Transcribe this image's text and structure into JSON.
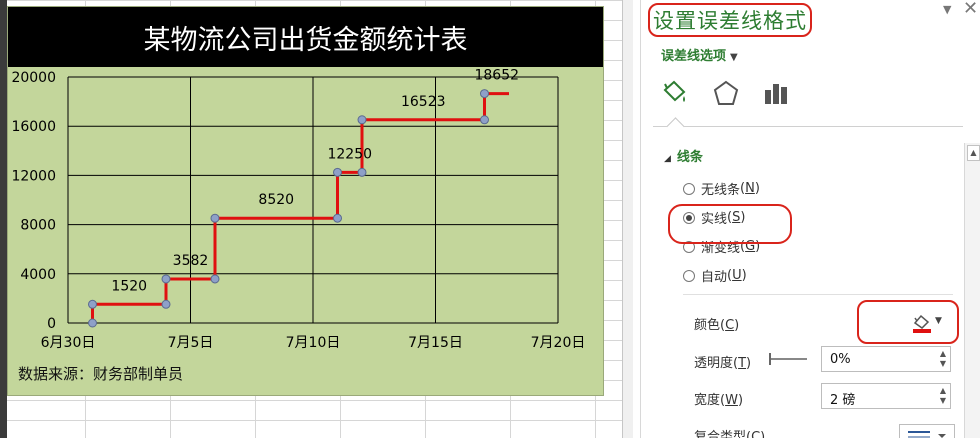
{
  "chart_data": {
    "type": "line",
    "title": "某物流公司出货金额统计表",
    "source_note": "数据来源：财务部制单员",
    "x_tick_labels": [
      "6月30日",
      "7月5日",
      "7月10日",
      "7月15日",
      "7月20日"
    ],
    "x_tick_days": [
      0,
      5,
      10,
      15,
      20
    ],
    "y_ticks": [
      0,
      4000,
      8000,
      12000,
      16000,
      20000
    ],
    "ylim": [
      0,
      20000
    ],
    "xlim_days": [
      0,
      20
    ],
    "grid": true,
    "step": true,
    "line_color": "#e01010",
    "marker_color": "#8ea0c8",
    "points": [
      {
        "x": "6月30日",
        "day": 1,
        "y": 0
      },
      {
        "x": "7月1日",
        "day": 1,
        "y": 1520
      },
      {
        "x": "7月4日",
        "day": 4,
        "y": 3582
      },
      {
        "x": "7月6日",
        "day": 6,
        "y": 8520
      },
      {
        "x": "7月11日",
        "day": 11,
        "y": 12250
      },
      {
        "x": "7月12日",
        "day": 12,
        "y": 16523
      },
      {
        "x": "7月17日",
        "day": 17,
        "y": 18652
      }
    ],
    "data_labels": [
      "1520",
      "3582",
      "8520",
      "12250",
      "16523",
      "18652"
    ]
  },
  "pane": {
    "title": "设置误差线格式",
    "options_label": "误差线选项",
    "tabs": [
      {
        "name": "fill-line",
        "icon": "paint-bucket-icon"
      },
      {
        "name": "effects",
        "icon": "pentagon-icon"
      },
      {
        "name": "options",
        "icon": "bar-chart-icon"
      }
    ],
    "section_title": "线条",
    "line_options": [
      {
        "label": "无线条",
        "key": "N",
        "selected": false
      },
      {
        "label": "实线",
        "key": "S",
        "selected": true
      },
      {
        "label": "渐变线",
        "key": "G",
        "selected": false
      },
      {
        "label": "自动",
        "key": "U",
        "selected": false
      }
    ],
    "color_label": "颜色",
    "color_key": "C",
    "color_value": "#e01010",
    "transparency_label": "透明度",
    "transparency_key": "T",
    "transparency_value": "0%",
    "width_label": "宽度",
    "width_key": "W",
    "width_value": "2 磅",
    "compound_label": "复合类型",
    "compound_key": "C",
    "highlight_color": "#d9241b"
  }
}
